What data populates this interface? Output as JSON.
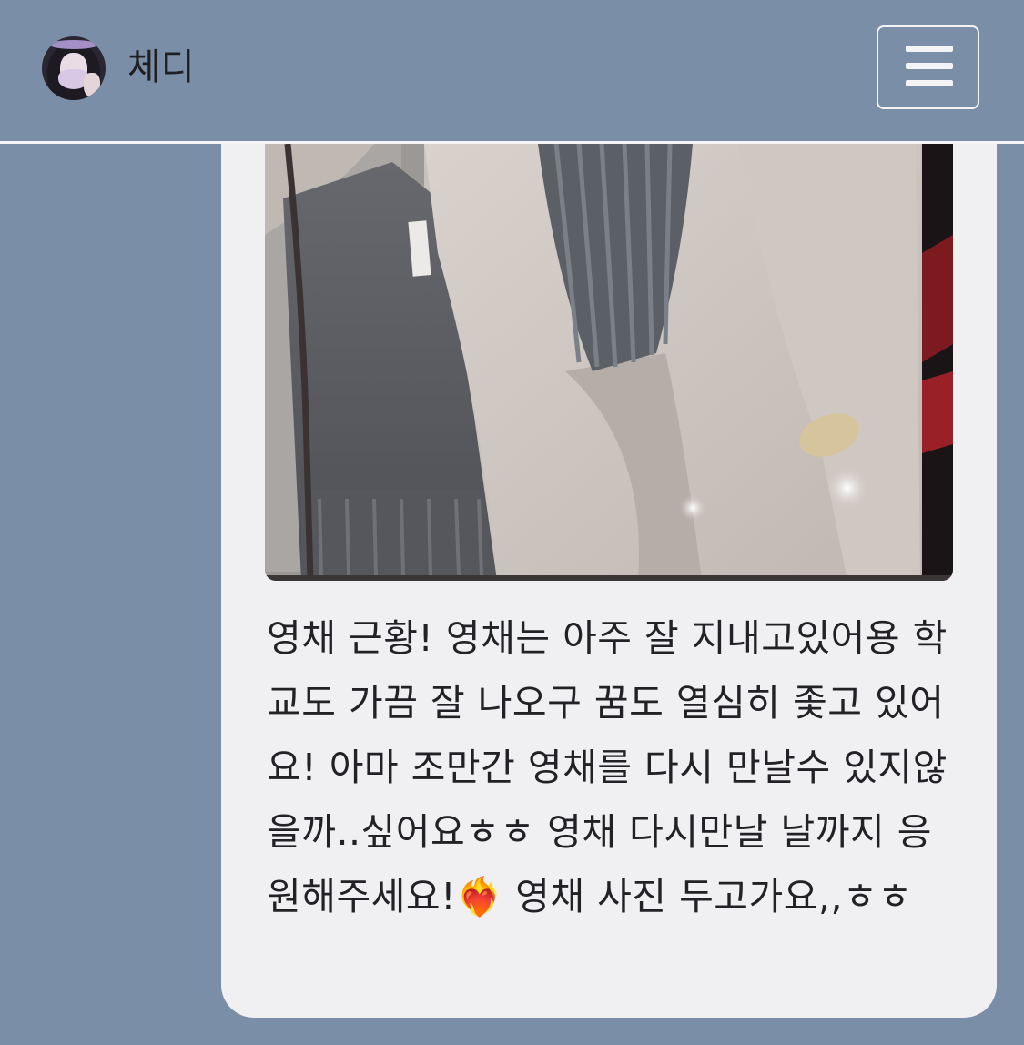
{
  "header": {
    "profile_name": "체디",
    "avatar_icon": "profile-avatar",
    "menu_icon": "hamburger-menu-icon"
  },
  "post": {
    "message": "영채 근황! 영채는 아주 잘 지내고있어용 학교도 가끔 잘 나오구 꿈도 열심히 좇고 있어요! 아마 조만간 영채를 다시 만날수 있지않을까..싶어요ㅎㅎ 영채 다시만날 날까지 응원해주세요!❤️‍🔥 영채 사진 두고가요,,ㅎㅎ"
  },
  "colors": {
    "background": "#7b8ea7",
    "bubble": "#f0f0f2",
    "header_line": "#f4f4f6",
    "text": "#222226"
  }
}
